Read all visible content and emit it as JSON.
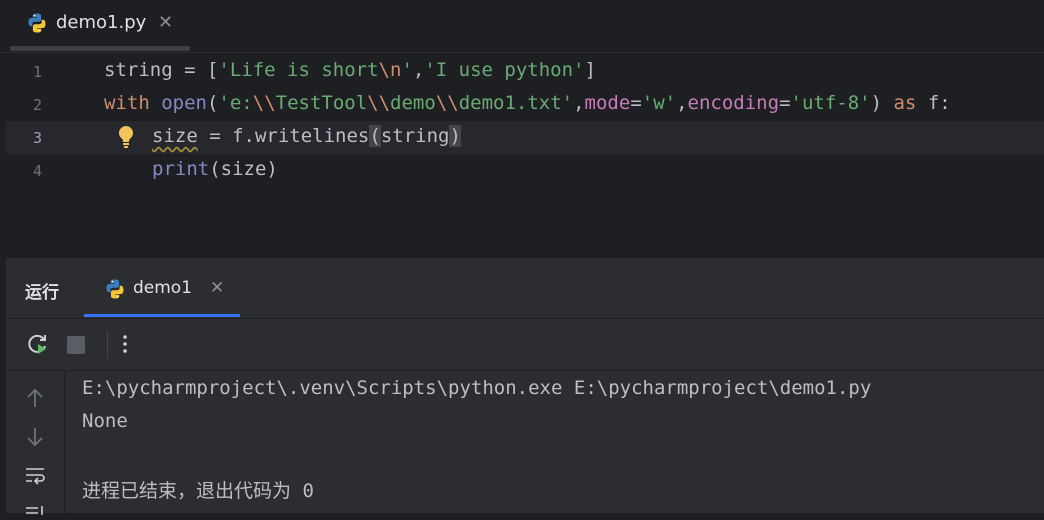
{
  "editor_tab": {
    "filename": "demo1.py",
    "close_symbol": "✕",
    "icon": "python-icon"
  },
  "editor": {
    "line_numbers": [
      "1",
      "2",
      "3",
      "4"
    ],
    "current_line": 3,
    "lines": [
      {
        "tokens": [
          {
            "t": "string = [",
            "c": "punc"
          },
          {
            "t": "'Life is short",
            "c": "s"
          },
          {
            "t": "\\n",
            "c": "esc"
          },
          {
            "t": "'",
            "c": "s"
          },
          {
            "t": ",",
            "c": "punc"
          },
          {
            "t": "'I use python'",
            "c": "s"
          },
          {
            "t": "]",
            "c": "punc"
          }
        ]
      },
      {
        "tokens": [
          {
            "t": "with ",
            "c": "kw"
          },
          {
            "t": "open",
            "c": "builtin"
          },
          {
            "t": "(",
            "c": "punc"
          },
          {
            "t": "'e:",
            "c": "s"
          },
          {
            "t": "\\\\",
            "c": "esc"
          },
          {
            "t": "TestTool",
            "c": "s"
          },
          {
            "t": "\\\\",
            "c": "esc"
          },
          {
            "t": "demo",
            "c": "s"
          },
          {
            "t": "\\\\",
            "c": "esc"
          },
          {
            "t": "demo1.txt'",
            "c": "s"
          },
          {
            "t": ",",
            "c": "punc"
          },
          {
            "t": "mode",
            "c": "kwarg"
          },
          {
            "t": "=",
            "c": "punc"
          },
          {
            "t": "'w'",
            "c": "s"
          },
          {
            "t": ",",
            "c": "punc"
          },
          {
            "t": "encoding",
            "c": "kwarg"
          },
          {
            "t": "=",
            "c": "punc"
          },
          {
            "t": "'utf-8'",
            "c": "s"
          },
          {
            "t": ") ",
            "c": "punc"
          },
          {
            "t": "as",
            "c": "kw"
          },
          {
            "t": " f:",
            "c": "punc"
          }
        ]
      },
      {
        "tokens": [
          {
            "t": "size",
            "c": "punc warn"
          },
          {
            "t": " = f.writelines",
            "c": "punc"
          },
          {
            "t": "(",
            "c": "punc paren-hl"
          },
          {
            "t": "string",
            "c": "punc"
          },
          {
            "t": ")",
            "c": "punc paren-hl"
          }
        ]
      },
      {
        "tokens": [
          {
            "t": "print",
            "c": "builtin"
          },
          {
            "t": "(size)",
            "c": "punc"
          }
        ]
      }
    ]
  },
  "run_panel": {
    "title": "运行",
    "tab_name": "demo1",
    "close_symbol": "✕",
    "toolbar": {
      "rerun": "rerun-icon",
      "stop": "stop-icon",
      "more": "more-vertical-icon"
    },
    "console_output": [
      "E:\\pycharmproject\\.venv\\Scripts\\python.exe E:\\pycharmproject\\demo1.py",
      "None",
      "",
      "进程已结束，退出代码为 0"
    ]
  },
  "colors": {
    "background": "#1e1f22",
    "panel": "#2b2d30",
    "string": "#6aab73",
    "keyword": "#cf8e6d",
    "kwarg": "#c77dbb",
    "builtin": "#8888c6",
    "accent": "#3574f0"
  }
}
